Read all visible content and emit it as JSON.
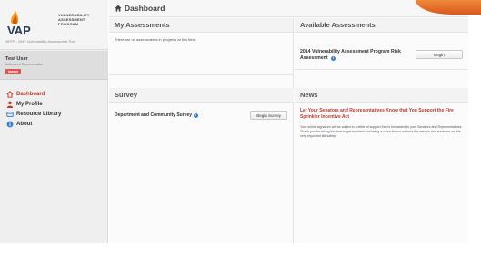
{
  "brand": {
    "logo_text_lines": [
      "VULNERABILITY",
      "ASSESSMENT",
      "PROGRAM"
    ],
    "logo_letters": "VAP",
    "tagline": "NFFF - VAP: Vulnerability Assessment Tool",
    "colors": {
      "accent": "#c0392b",
      "flame_orange": "#f39c12",
      "flame_red": "#d35400",
      "corner_orange": "#e66b25"
    }
  },
  "user": {
    "name": "Test User",
    "role": "Authorized Representative",
    "logout_label": "logout"
  },
  "nav": {
    "items": [
      {
        "label": "Dashboard",
        "icon": "home-icon",
        "active": true
      },
      {
        "label": "My Profile",
        "icon": "user-icon",
        "active": false
      },
      {
        "label": "Resource Library",
        "icon": "book-icon",
        "active": false
      },
      {
        "label": "About",
        "icon": "info-icon",
        "active": false
      }
    ]
  },
  "header": {
    "title": "Dashboard",
    "icon": "home-icon"
  },
  "my_assessments": {
    "heading": "My Assessments",
    "empty_text": "There are no assessments in progress at this time."
  },
  "survey": {
    "heading": "Survey",
    "item_name": "Department and Community Survey",
    "button_label": "Begin Survey"
  },
  "available": {
    "heading": "Available Assessments",
    "item_name": "2014 Vulnerability Assessment Program Risk Assessment",
    "button_label": "Begin"
  },
  "news": {
    "heading": "News",
    "title": "Let Your Senators and Representatives Know that You Support the Fire Sprinkler Incentive Act",
    "body": "Your online signature will be added to a letter of support that is forwarded to your Senators and Representatives. Thank you for taking the time to get involved and being a voice for our nation's fire service and survivors on this very important life safety!"
  }
}
